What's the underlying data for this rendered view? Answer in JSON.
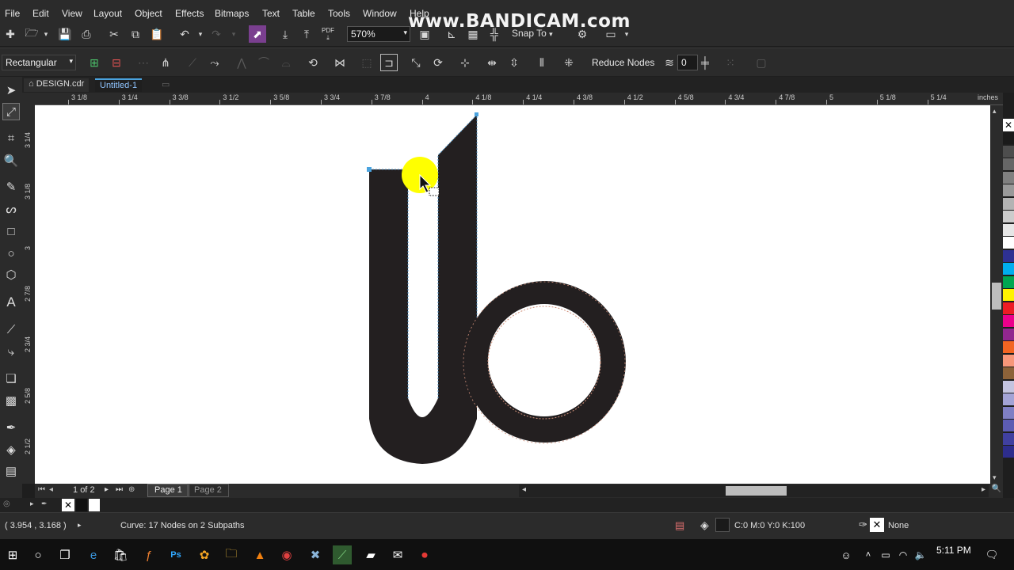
{
  "menu": [
    "File",
    "Edit",
    "View",
    "Layout",
    "Object",
    "Effects",
    "Bitmaps",
    "Text",
    "Table",
    "Tools",
    "Window",
    "Help"
  ],
  "watermark": "www.BANDICAM.com",
  "toolbar": {
    "zoom_value": "570%",
    "snap_label": "Snap To",
    "pdf_label": "PDF"
  },
  "property_bar": {
    "selection_mode": "Rectangular",
    "reduce_nodes_label": "Reduce Nodes",
    "smoothness_value": "0"
  },
  "tabs": {
    "design": "DESIGN.cdr",
    "untitled": "Untitled-1"
  },
  "ruler": {
    "h_labels": [
      "3 1/8",
      "3 1/4",
      "3 3/8",
      "3 1/2",
      "3 5/8",
      "3 3/4",
      "3 7/8",
      "4",
      "4 1/8",
      "4 1/4",
      "4 3/8",
      "4 1/2",
      "4 5/8",
      "4 3/4",
      "4 7/8",
      "5",
      "5 1/8",
      "5 1/4"
    ],
    "unit": "inches",
    "v_labels": [
      "3 1/4",
      "3 1/8",
      "3",
      "2 7/8",
      "2 3/4",
      "2 5/8",
      "2 1/2"
    ]
  },
  "pages": {
    "counter_current": "1",
    "counter_of": "of",
    "counter_total": "2",
    "page1": "Page 1",
    "page2": "Page 2"
  },
  "status": {
    "coordinates": "( 3.954 , 3.168 )",
    "selection_info": "Curve: 17 Nodes on 2 Subpaths",
    "fill_color": "C:0 M:0 Y:0 K:100",
    "outline": "None"
  },
  "taskbar": {
    "time": "5:11 PM"
  },
  "colors": {
    "shape_fill": "#231f20",
    "highlight": "#ffff00",
    "accent": "#4aa3df",
    "canvas": "#ffffff"
  },
  "palette_colors": [
    "#1a1a1a",
    "#4d4d4d",
    "#666666",
    "#808080",
    "#999999",
    "#b3b3b3",
    "#cccccc",
    "#e6e6e6",
    "#ffffff",
    "#2e3192",
    "#00aeef",
    "#00a651",
    "#fff200",
    "#ed1c24",
    "#ec008c",
    "#92278f",
    "#f26522",
    "#f7977a",
    "#8c6239",
    "#c4c4e0",
    "#a3a3d6",
    "#7f7fc4",
    "#5c5cb3",
    "#4040a0",
    "#2d2d8c"
  ]
}
